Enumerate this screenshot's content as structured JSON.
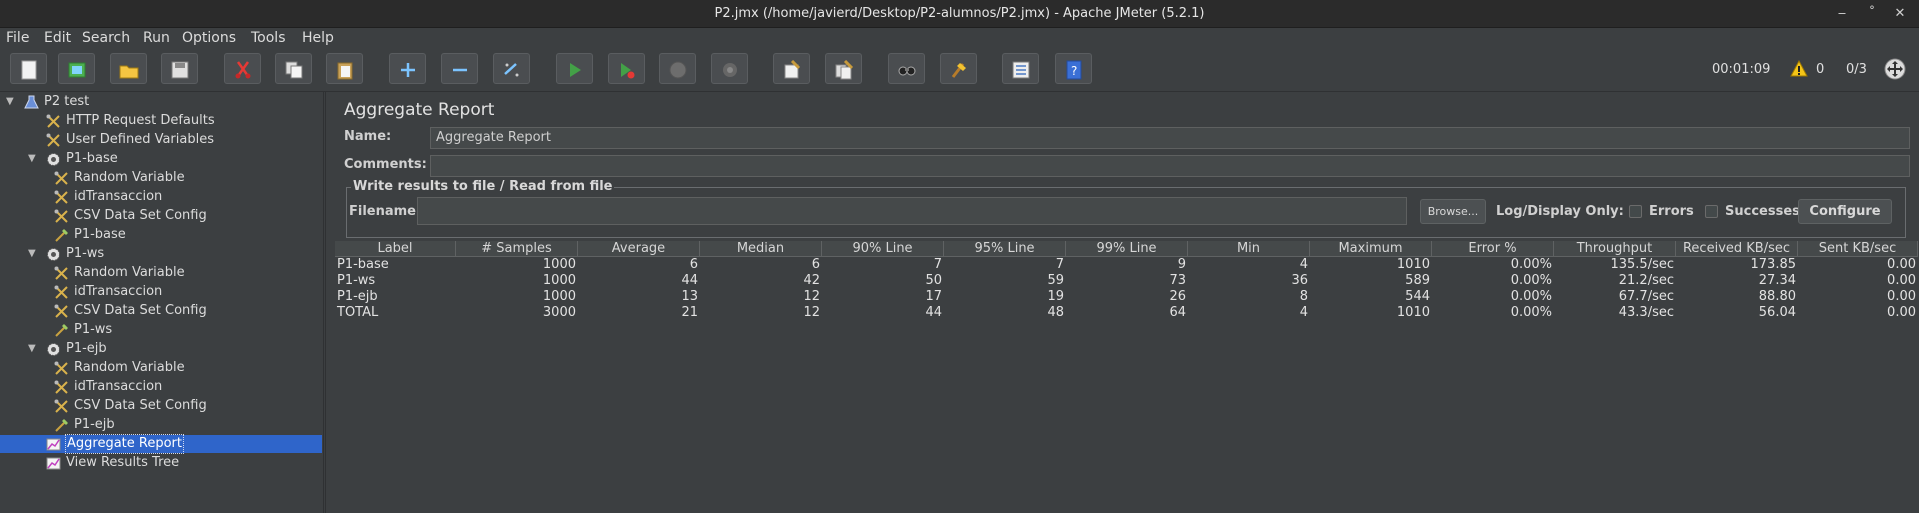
{
  "window": {
    "title": "P2.jmx (/home/javierd/Desktop/P2-alumnos/P2.jmx) - Apache JMeter (5.2.1)",
    "minimize": "‒",
    "restore": "˚",
    "close": "✕"
  },
  "menu": [
    "File",
    "Edit",
    "Search",
    "Run",
    "Options",
    "Tools",
    "Help"
  ],
  "toolbar": {
    "elapsed": "00:01:09",
    "warnings": "0",
    "threads": "0/3",
    "buttons": [
      "new-icon",
      "templates-icon",
      "open-icon",
      "save-icon",
      "cut-icon",
      "copy-icon",
      "paste-icon",
      "expand-icon",
      "collapse-icon",
      "toggle-icon",
      "start-icon",
      "start-no-pauses-icon",
      "stop-icon",
      "shutdown-icon",
      "clear-icon",
      "clear-all-icon",
      "search-icon",
      "reset-search-icon",
      "function-helper-icon",
      "help-icon"
    ]
  },
  "tree": [
    {
      "label": "P2 test",
      "icon": "flask",
      "level": 0,
      "toggle": "▼"
    },
    {
      "label": "HTTP Request Defaults",
      "icon": "config",
      "level": 1
    },
    {
      "label": "User Defined Variables",
      "icon": "config",
      "level": 1
    },
    {
      "label": "P1-base",
      "icon": "gear",
      "level": 1,
      "toggle": "▼"
    },
    {
      "label": "Random Variable",
      "icon": "config",
      "level": 2
    },
    {
      "label": "idTransaccion",
      "icon": "config",
      "level": 2
    },
    {
      "label": "CSV Data Set Config",
      "icon": "config",
      "level": 2
    },
    {
      "label": "P1-base",
      "icon": "sampler",
      "level": 2
    },
    {
      "label": "P1-ws",
      "icon": "gear",
      "level": 1,
      "toggle": "▼"
    },
    {
      "label": "Random Variable",
      "icon": "config",
      "level": 2
    },
    {
      "label": "idTransaccion",
      "icon": "config",
      "level": 2
    },
    {
      "label": "CSV Data Set Config",
      "icon": "config",
      "level": 2
    },
    {
      "label": "P1-ws",
      "icon": "sampler",
      "level": 2
    },
    {
      "label": "P1-ejb",
      "icon": "gear",
      "level": 1,
      "toggle": "▼"
    },
    {
      "label": "Random Variable",
      "icon": "config",
      "level": 2
    },
    {
      "label": "idTransaccion",
      "icon": "config",
      "level": 2
    },
    {
      "label": "CSV Data Set Config",
      "icon": "config",
      "level": 2
    },
    {
      "label": "P1-ejb",
      "icon": "sampler",
      "level": 2
    },
    {
      "label": "Aggregate Report",
      "icon": "listener",
      "level": 1,
      "selected": true
    },
    {
      "label": "View Results Tree",
      "icon": "listener",
      "level": 1
    }
  ],
  "panel": {
    "title": "Aggregate Report",
    "name_label": "Name:",
    "name_value": "Aggregate Report",
    "comments_label": "Comments:",
    "comments_value": "",
    "fieldset_legend": "Write results to file / Read from file",
    "filename_label": "Filename",
    "filename_value": "",
    "browse": "Browse...",
    "log_display_only": "Log/Display Only:",
    "errors": "Errors",
    "successes": "Successes",
    "configure": "Configure"
  },
  "table": {
    "columns": [
      "Label",
      "# Samples",
      "Average",
      "Median",
      "90% Line",
      "95% Line",
      "99% Line",
      "Min",
      "Maximum",
      "Error %",
      "Throughput",
      "Received KB/sec",
      "Sent KB/sec"
    ],
    "rows": [
      [
        "P1-base",
        "1000",
        "6",
        "6",
        "7",
        "7",
        "9",
        "4",
        "1010",
        "0.00%",
        "135.5/sec",
        "173.85",
        "0.00"
      ],
      [
        "P1-ws",
        "1000",
        "44",
        "42",
        "50",
        "59",
        "73",
        "36",
        "589",
        "0.00%",
        "21.2/sec",
        "27.34",
        "0.00"
      ],
      [
        "P1-ejb",
        "1000",
        "13",
        "12",
        "17",
        "19",
        "26",
        "8",
        "544",
        "0.00%",
        "67.7/sec",
        "88.80",
        "0.00"
      ],
      [
        "TOTAL",
        "3000",
        "21",
        "12",
        "44",
        "48",
        "64",
        "4",
        "1010",
        "0.00%",
        "43.3/sec",
        "56.04",
        "0.00"
      ]
    ]
  }
}
